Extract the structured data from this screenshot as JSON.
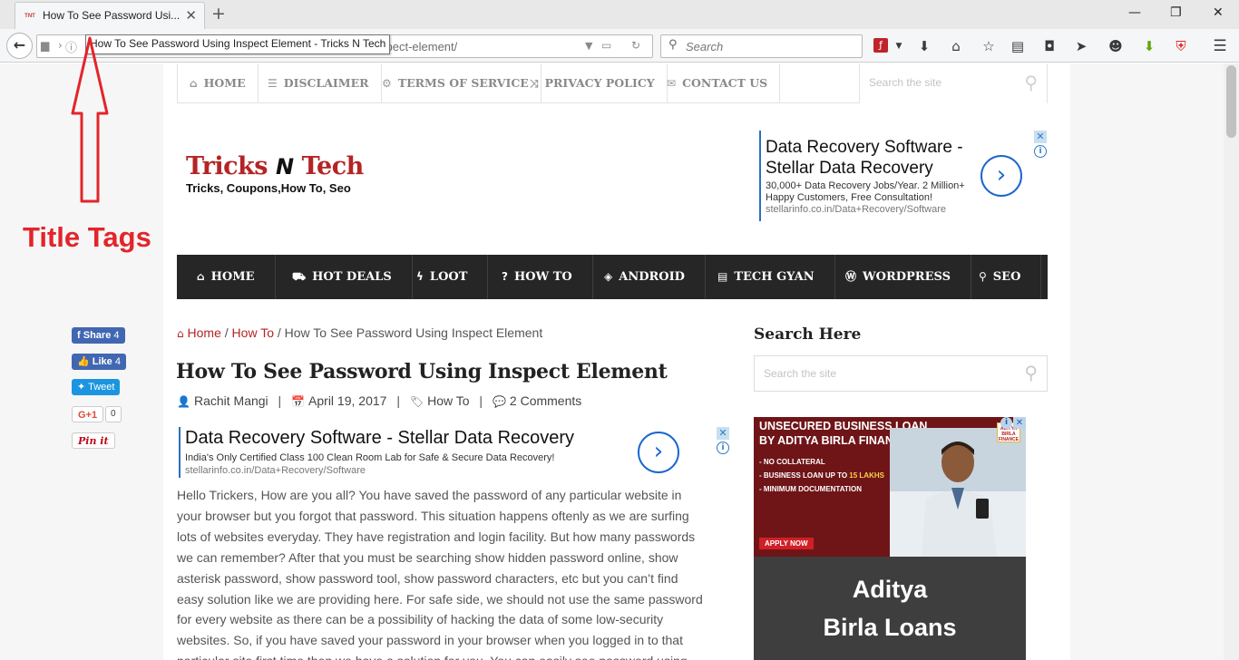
{
  "browser": {
    "tab": {
      "favicon_text": "TNT",
      "title": "How To See Password Usi...",
      "close": "✕"
    },
    "new_tab": "+",
    "window": {
      "minimize": "—",
      "restore": "❐",
      "close": "✕"
    },
    "url_tail": "spect-element/",
    "search_placeholder": "Search",
    "tooltip": "How To See Password Using Inspect Element - Tricks N Tech"
  },
  "top_menu": {
    "items": [
      {
        "icon": "home-icon",
        "glyph": "⌂",
        "label": "HOME"
      },
      {
        "icon": "list-icon",
        "glyph": "☰",
        "label": "DISCLAIMER"
      },
      {
        "icon": "gear-icon",
        "glyph": "⚙",
        "label": "TERMS OF SERVICE"
      },
      {
        "icon": "shuffle-icon",
        "glyph": "⤨",
        "label": "PRIVACY POLICY"
      },
      {
        "icon": "envelope-icon",
        "glyph": "✉",
        "label": "CONTACT US"
      }
    ],
    "search_placeholder": "Search the site"
  },
  "logo": {
    "word1": "Tricks",
    "n": "N",
    "word2": "Tech",
    "tagline": "Tricks, Coupons,How To, Seo"
  },
  "header_ad": {
    "title_line1": "Data Recovery Software -",
    "title_line2": "Stellar Data Recovery",
    "desc_line1": "30,000+ Data Recovery Jobs/Year. 2 Million+",
    "desc_line2": "Happy Customers, Free Consultation!",
    "url": "stellarinfo.co.in/Data+Recovery/Software"
  },
  "main_nav": {
    "items": [
      {
        "icon": "home-icon",
        "glyph": "⌂",
        "label": "HOME"
      },
      {
        "icon": "cart-icon",
        "glyph": "⛟",
        "label": "HOT DEALS"
      },
      {
        "icon": "bolt-icon",
        "glyph": "ϟ",
        "label": "LOOT"
      },
      {
        "icon": "question-icon",
        "glyph": "?",
        "label": "HOW TO"
      },
      {
        "icon": "android-icon",
        "glyph": "◈",
        "label": "ANDROID"
      },
      {
        "icon": "book-icon",
        "glyph": "▤",
        "label": "TECH GYAN"
      },
      {
        "icon": "wordpress-icon",
        "glyph": "Ⓦ",
        "label": "WORDPRESS"
      },
      {
        "icon": "search-icon",
        "glyph": "⚲",
        "label": "SEO"
      }
    ]
  },
  "social": {
    "share_label": "Share",
    "share_count": "4",
    "like_label": "Like",
    "like_count": "4",
    "tweet_label": "Tweet",
    "gplus_label": "G+1",
    "gplus_count": "0",
    "pin_label": "Pin it"
  },
  "breadcrumb": {
    "home": "Home",
    "sep1": "/",
    "category": "How To",
    "sep2": "/",
    "current": "How To See Password Using Inspect Element"
  },
  "post": {
    "title": "How To See Password Using Inspect Element",
    "author": "Rachit Mangi",
    "date": "April 19, 2017",
    "category": "How To",
    "comments": "2 Comments",
    "meta_sep": "|",
    "body": [
      "Hello Trickers, How are you all? You have saved the password of any particular website in",
      "your browser but you forgot that password. This situation happens oftenly as we are surfing",
      "lots of websites everyday. They have registration and login facility. But how many passwords",
      "we can remember? After that you must be searching show hidden password online, show",
      "asterisk password, show password tool, show password characters, etc but you can’t find",
      "easy solution like we are providing here. For safe side, we should not use the same password",
      "for every website as there can be a possibility of hacking the data of some low-security",
      "websites. So, if you have saved your password in your browser when you logged in to that",
      "particular site first time then we have a solution for you. You can easily see password using"
    ]
  },
  "inline_ad": {
    "title": "Data Recovery Software - Stellar Data Recovery",
    "desc": "India's Only Certified Class 100 Clean Room Lab for Safe & Secure Data Recovery!",
    "url": "stellarinfo.co.in/Data+Recovery/Software"
  },
  "sidebar": {
    "title": "Search Here",
    "search_placeholder": "Search the site"
  },
  "sidebar_banner": {
    "headline_line1": "UNSECURED BUSINESS LOAN",
    "headline_line2": "BY ADITYA BIRLA FINANCE",
    "bullet1": "- NO COLLATERAL",
    "bullet2_prefix": "- BUSINESS LOAN UP TO ",
    "bullet2_value": "15 LAKHS",
    "bullet3": "- MINIMUM DOCUMENTATION",
    "apply": "APPLY NOW",
    "logo_text": "ADITYA BIRLA FINANCE",
    "big_line1": "Aditya",
    "big_line2": "Birla Loans"
  },
  "annotation": {
    "label": "Title Tags"
  },
  "colors": {
    "brand_red": "#b52425",
    "nav_dark": "#262626",
    "annotation_red": "#e2252b",
    "ad_blue": "#1a66d0"
  }
}
